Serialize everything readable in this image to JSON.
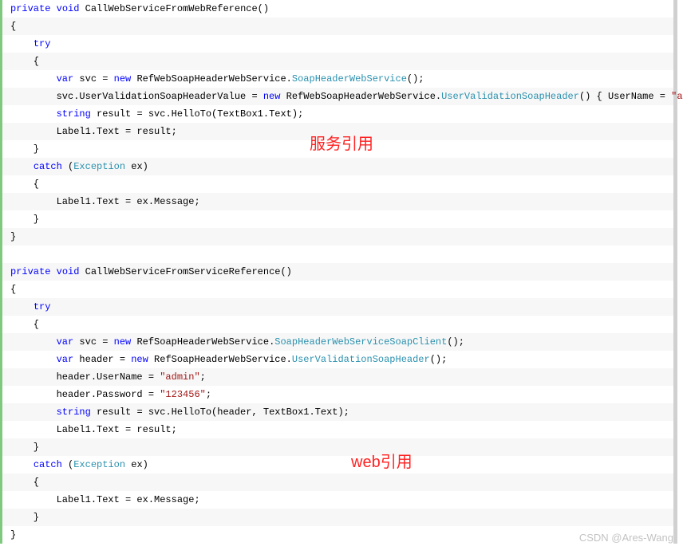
{
  "annotations": {
    "serviceRef": "服务引用",
    "webRef": "web引用"
  },
  "watermark": "CSDN @Ares-Wang",
  "code_lines": [
    [
      {
        "t": "kw",
        "s": "private"
      },
      {
        "t": "plain",
        "s": " "
      },
      {
        "t": "kw",
        "s": "void"
      },
      {
        "t": "plain",
        "s": " CallWebServiceFromWebReference()"
      }
    ],
    [
      {
        "t": "plain",
        "s": "{"
      }
    ],
    [
      {
        "t": "plain",
        "s": "    "
      },
      {
        "t": "kw",
        "s": "try"
      }
    ],
    [
      {
        "t": "plain",
        "s": "    {"
      }
    ],
    [
      {
        "t": "plain",
        "s": "        "
      },
      {
        "t": "kw",
        "s": "var"
      },
      {
        "t": "plain",
        "s": " svc = "
      },
      {
        "t": "kw",
        "s": "new"
      },
      {
        "t": "plain",
        "s": " RefWebSoapHeaderWebService."
      },
      {
        "t": "type",
        "s": "SoapHeaderWebService"
      },
      {
        "t": "plain",
        "s": "();"
      }
    ],
    [
      {
        "t": "plain",
        "s": "        svc.UserValidationSoapHeaderValue = "
      },
      {
        "t": "kw",
        "s": "new"
      },
      {
        "t": "plain",
        "s": " RefWebSoapHeaderWebService."
      },
      {
        "t": "type",
        "s": "UserValidationSoapHeader"
      },
      {
        "t": "plain",
        "s": "() { UserName = "
      },
      {
        "t": "str",
        "s": "\"admin"
      }
    ],
    [
      {
        "t": "plain",
        "s": "        "
      },
      {
        "t": "kw",
        "s": "string"
      },
      {
        "t": "plain",
        "s": " result = svc.HelloTo(TextBox1.Text);"
      }
    ],
    [
      {
        "t": "plain",
        "s": "        Label1.Text = result;"
      }
    ],
    [
      {
        "t": "plain",
        "s": "    }"
      }
    ],
    [
      {
        "t": "plain",
        "s": "    "
      },
      {
        "t": "kw",
        "s": "catch"
      },
      {
        "t": "plain",
        "s": " ("
      },
      {
        "t": "type",
        "s": "Exception"
      },
      {
        "t": "plain",
        "s": " ex)"
      }
    ],
    [
      {
        "t": "plain",
        "s": "    {"
      }
    ],
    [
      {
        "t": "plain",
        "s": "        Label1.Text = ex.Message;"
      }
    ],
    [
      {
        "t": "plain",
        "s": "    }"
      }
    ],
    [
      {
        "t": "plain",
        "s": "}"
      }
    ],
    [
      {
        "t": "plain",
        "s": ""
      }
    ],
    [
      {
        "t": "kw",
        "s": "private"
      },
      {
        "t": "plain",
        "s": " "
      },
      {
        "t": "kw",
        "s": "void"
      },
      {
        "t": "plain",
        "s": " CallWebServiceFromServiceReference()"
      }
    ],
    [
      {
        "t": "plain",
        "s": "{"
      }
    ],
    [
      {
        "t": "plain",
        "s": "    "
      },
      {
        "t": "kw",
        "s": "try"
      }
    ],
    [
      {
        "t": "plain",
        "s": "    {"
      }
    ],
    [
      {
        "t": "plain",
        "s": "        "
      },
      {
        "t": "kw",
        "s": "var"
      },
      {
        "t": "plain",
        "s": " svc = "
      },
      {
        "t": "kw",
        "s": "new"
      },
      {
        "t": "plain",
        "s": " RefSoapHeaderWebService."
      },
      {
        "t": "type",
        "s": "SoapHeaderWebServiceSoapClient"
      },
      {
        "t": "plain",
        "s": "();"
      }
    ],
    [
      {
        "t": "plain",
        "s": "        "
      },
      {
        "t": "kw",
        "s": "var"
      },
      {
        "t": "plain",
        "s": " header = "
      },
      {
        "t": "kw",
        "s": "new"
      },
      {
        "t": "plain",
        "s": " RefSoapHeaderWebService."
      },
      {
        "t": "type",
        "s": "UserValidationSoapHeader"
      },
      {
        "t": "plain",
        "s": "();"
      }
    ],
    [
      {
        "t": "plain",
        "s": "        header.UserName = "
      },
      {
        "t": "str",
        "s": "\"admin\""
      },
      {
        "t": "plain",
        "s": ";"
      }
    ],
    [
      {
        "t": "plain",
        "s": "        header.Password = "
      },
      {
        "t": "str",
        "s": "\"123456\""
      },
      {
        "t": "plain",
        "s": ";"
      }
    ],
    [
      {
        "t": "plain",
        "s": "        "
      },
      {
        "t": "kw",
        "s": "string"
      },
      {
        "t": "plain",
        "s": " result = svc.HelloTo(header, TextBox1.Text);"
      }
    ],
    [
      {
        "t": "plain",
        "s": "        Label1.Text = result;"
      }
    ],
    [
      {
        "t": "plain",
        "s": "    }"
      }
    ],
    [
      {
        "t": "plain",
        "s": "    "
      },
      {
        "t": "kw",
        "s": "catch"
      },
      {
        "t": "plain",
        "s": " ("
      },
      {
        "t": "type",
        "s": "Exception"
      },
      {
        "t": "plain",
        "s": " ex)"
      }
    ],
    [
      {
        "t": "plain",
        "s": "    {"
      }
    ],
    [
      {
        "t": "plain",
        "s": "        Label1.Text = ex.Message;"
      }
    ],
    [
      {
        "t": "plain",
        "s": "    }"
      }
    ],
    [
      {
        "t": "plain",
        "s": "}"
      }
    ]
  ]
}
